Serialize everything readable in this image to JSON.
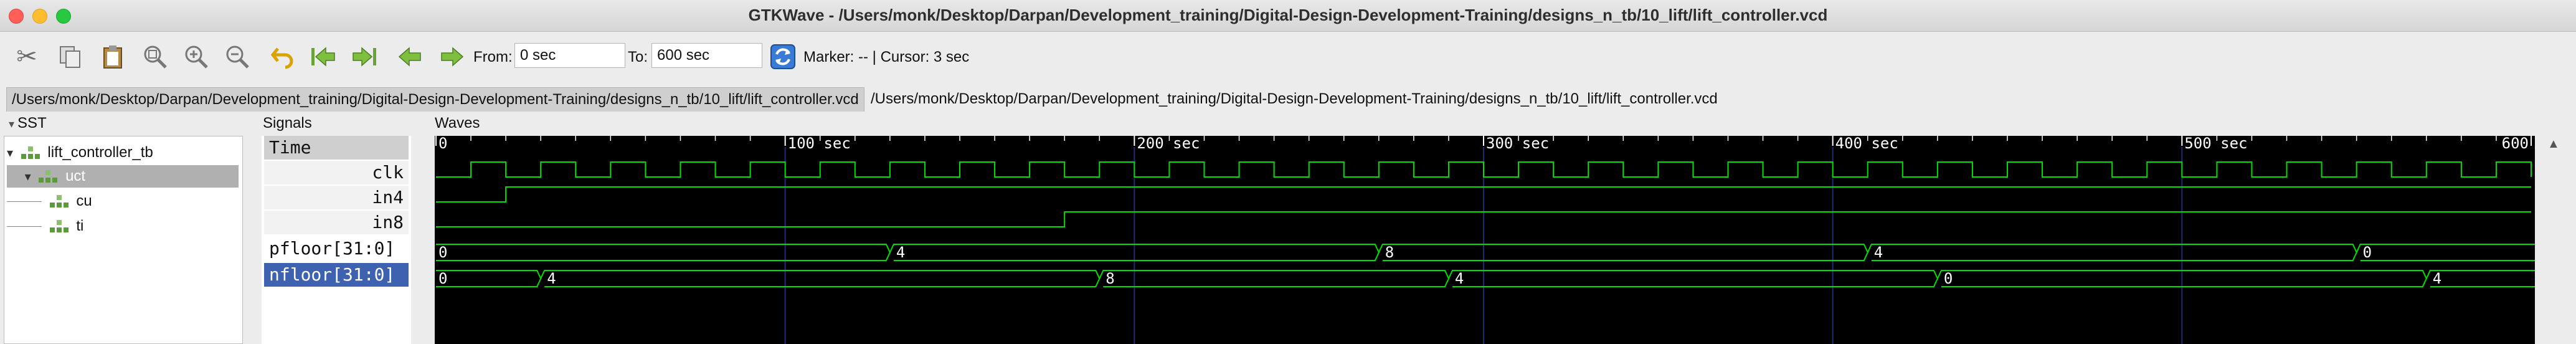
{
  "window": {
    "title": "GTKWave - /Users/monk/Desktop/Darpan/Development_training/Digital-Design-Development-Training/designs_n_tb/10_lift/lift_controller.vcd",
    "controls": {
      "close_color": "#ff5f57",
      "minimize_color": "#febc2e",
      "zoom_color": "#28c840"
    }
  },
  "toolbar": {
    "icons": [
      "cut-icon",
      "copy-icon",
      "paste-icon",
      "zoom-fit-icon",
      "zoom-in-icon",
      "zoom-out-icon",
      "undo-icon",
      "jump-start-icon",
      "jump-end-icon",
      "prev-edge-icon",
      "next-edge-icon"
    ],
    "from_label": "From:",
    "from_value": "0 sec",
    "to_label": "To:",
    "to_value": "600 sec",
    "reload_icon": "reload-icon",
    "marker_text": "Marker: --  |  Cursor: 3 sec"
  },
  "tabs": [
    {
      "label": "/Users/monk/Desktop/Darpan/Development_training/Digital-Design-Development-Training/designs_n_tb/10_lift/lift_controller.vcd",
      "active": true
    },
    {
      "label": "/Users/monk/Desktop/Darpan/Development_training/Digital-Design-Development-Training/designs_n_tb/10_lift/lift_controller.vcd",
      "active": false
    }
  ],
  "sst": {
    "header": "SST",
    "tree": [
      {
        "label": "lift_controller_tb",
        "level": 0,
        "selected": false
      },
      {
        "label": "uct",
        "level": 1,
        "selected": true
      },
      {
        "label": "cu",
        "level": 2,
        "selected": false
      },
      {
        "label": "ti",
        "level": 2,
        "selected": false
      }
    ]
  },
  "signals": {
    "header": "Signals",
    "items": [
      {
        "name": "Time",
        "style": "header"
      },
      {
        "name": "clk",
        "style": "right"
      },
      {
        "name": "in4",
        "style": "right"
      },
      {
        "name": "in8",
        "style": "right"
      },
      {
        "name": "pfloor[31:0]",
        "style": "left"
      },
      {
        "name": "nfloor[31:0]",
        "style": "selected"
      }
    ]
  },
  "waves": {
    "header": "Waves",
    "time_range": [
      0,
      600
    ],
    "major_ticks": [
      {
        "t": 0,
        "label": "0"
      },
      {
        "t": 100,
        "label": "100 sec"
      },
      {
        "t": 200,
        "label": "200 sec"
      },
      {
        "t": 300,
        "label": "300 sec"
      },
      {
        "t": 400,
        "label": "400 sec"
      },
      {
        "t": 500,
        "label": "500 sec"
      },
      {
        "t": 600,
        "label": "600"
      }
    ],
    "clk": {
      "period": 20,
      "first_rise": 10
    },
    "in4": {
      "initial": 0,
      "rises_at": 20
    },
    "in8": {
      "initial": 0,
      "rises_at": 180
    },
    "pfloor": [
      {
        "t": 0,
        "value": "0"
      },
      {
        "t": 130,
        "value": "4"
      },
      {
        "t": 270,
        "value": "8"
      },
      {
        "t": 410,
        "value": "4"
      },
      {
        "t": 550,
        "value": "0"
      }
    ],
    "nfloor": [
      {
        "t": 0,
        "value": "0"
      },
      {
        "t": 30,
        "value": "4"
      },
      {
        "t": 190,
        "value": "8"
      },
      {
        "t": 290,
        "value": "4"
      },
      {
        "t": 430,
        "value": "0"
      },
      {
        "t": 570,
        "value": "4"
      }
    ],
    "colors": {
      "trace": "#00e000",
      "grid": "#1e2a78",
      "text": "#ffffff",
      "bg": "#000000"
    }
  }
}
